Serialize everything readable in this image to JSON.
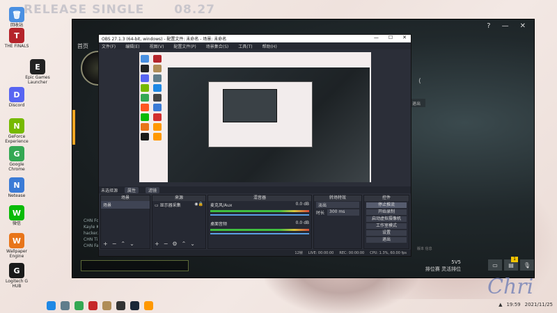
{
  "banner": {
    "title": "RELEASE SINGLE",
    "date": "08.27"
  },
  "desktop_icons": [
    {
      "label": "回收站",
      "color": "#4a90e2",
      "glyph": "🗑"
    },
    {
      "label": "THE FINALS",
      "color": "#b5242b",
      "glyph": "T"
    },
    {
      "label": "Epic Games Launcher",
      "color": "#222",
      "glyph": "E"
    },
    {
      "label": "Discord",
      "color": "#5865f2",
      "glyph": "D"
    },
    {
      "label": "GeForce Experience",
      "color": "#76b900",
      "glyph": "N"
    },
    {
      "label": "Google Chrome",
      "color": "#34a853",
      "glyph": "G"
    },
    {
      "label": "Netease",
      "color": "#3b7bd6",
      "glyph": "N"
    },
    {
      "label": "微信",
      "color": "#09bb07",
      "glyph": "W"
    },
    {
      "label": "Wallpaper Engine",
      "color": "#e8751a",
      "glyph": "W"
    },
    {
      "label": "Logitech G HUB",
      "color": "#1a1a1a",
      "glyph": "G"
    }
  ],
  "game": {
    "tab_title": "首页",
    "chat_lines": [
      "CHN Fo...",
      "Kayle K...",
      "hacker...",
      "CHN Ti...",
      "CHN Fa..."
    ],
    "rank_code": "5V5",
    "rank_text": "排位赛 灵活排位",
    "badge": "1",
    "side_button": "退出",
    "share_icon": "⟨",
    "footer": "版本 信息"
  },
  "obs": {
    "title": "OBS 27.1.3 (64-bit, windows) - 配置文件: 未命名 - 场景: 未命名",
    "menu": [
      "文件(F)",
      "编辑(E)",
      "视图(V)",
      "配置文件(P)",
      "场景集合(S)",
      "工具(T)",
      "帮助(H)"
    ],
    "toolbar": {
      "no_source": "未选择源",
      "properties": "属性",
      "filters": "滤镜"
    },
    "docks": {
      "scenes": {
        "title": "场景",
        "items": [
          "场景"
        ]
      },
      "sources": {
        "title": "来源",
        "items": [
          "显示器采集"
        ]
      },
      "mixer": {
        "title": "混音器",
        "channels": [
          {
            "name": "桌面音频",
            "db": "0.0 dB"
          },
          {
            "name": "麦克风/Aux",
            "db": "0.0 dB"
          }
        ]
      },
      "transitions": {
        "title": "转场特效",
        "type": "淡出",
        "duration_label": "时长",
        "duration": "300 ms"
      },
      "controls": {
        "title": "控件",
        "buttons": [
          "停止推流",
          "开始录制",
          "启动虚拟摄像机",
          "工作室模式",
          "设置",
          "退出"
        ]
      }
    },
    "status": {
      "live": "LIVE: 00:00:00",
      "rec": "REC: 00:00:00",
      "cpu": "CPU: 1.3%, 60.00 fps",
      "frames": "12帧"
    }
  },
  "taskbar": {
    "icons": [
      {
        "name": "windows-start",
        "color": "#1e88e5"
      },
      {
        "name": "search",
        "color": "#607d8b"
      },
      {
        "name": "chrome",
        "color": "#34a853"
      },
      {
        "name": "game",
        "color": "#c62828"
      },
      {
        "name": "league",
        "color": "#b08d57"
      },
      {
        "name": "obs",
        "color": "#333"
      },
      {
        "name": "steam",
        "color": "#1b2838"
      },
      {
        "name": "app",
        "color": "#ff9800"
      }
    ],
    "tray_time": "19:59",
    "tray_date": "2021/11/25"
  }
}
